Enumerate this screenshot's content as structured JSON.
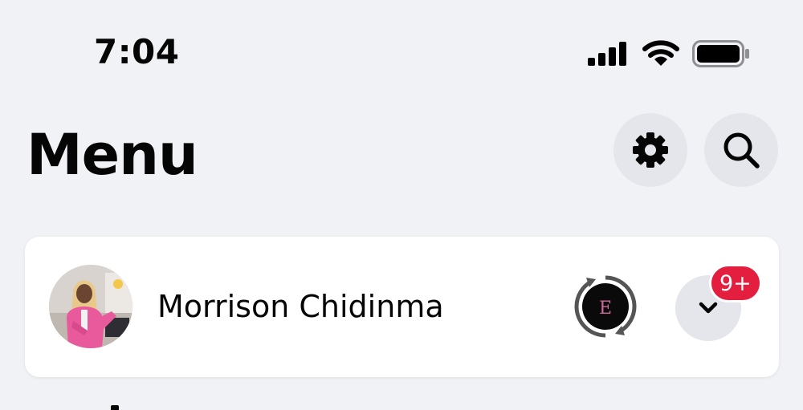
{
  "status_bar": {
    "time": "7:04",
    "icons": [
      "cellular-signal-icon",
      "wifi-icon",
      "battery-icon"
    ]
  },
  "header": {
    "title": "Menu",
    "actions": [
      {
        "name": "settings",
        "icon": "gear-icon"
      },
      {
        "name": "search",
        "icon": "search-icon"
      }
    ]
  },
  "profile": {
    "name": "Morrison Chidinma",
    "page_switch_letter": "E",
    "notification_badge": "9+",
    "dropdown_icon": "chevron-down-icon"
  },
  "colors": {
    "background": "#f0f2f5",
    "card": "#ffffff",
    "button_bg": "#e4e6eb",
    "badge_red": "#e41e3f",
    "avatar_outfit_pink": "#e85a9c"
  }
}
